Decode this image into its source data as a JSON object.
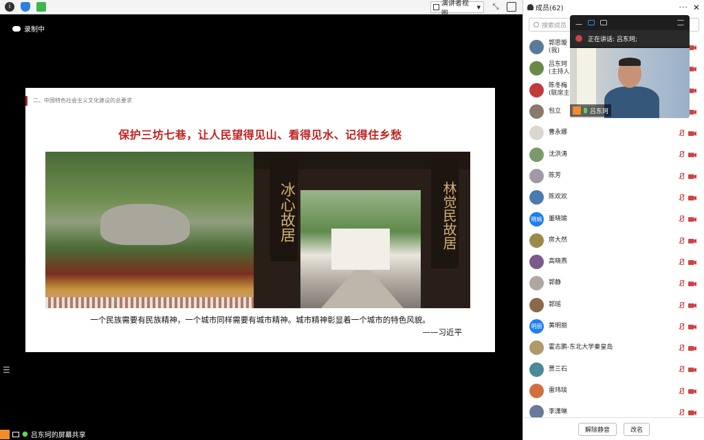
{
  "toolbar": {
    "view_label": "演讲者视图"
  },
  "recording": {
    "label": "录制中"
  },
  "slide": {
    "section": "二、中国特色社会主义文化建设的总要求",
    "title": "保护三坊七巷，让人民望得见山、看得见水、记得住乡愁",
    "quote": "一个民族需要有民族精神，一个城市同样需要有城市精神。城市精神彰显着一个城市的特色风貌。",
    "author": "——习近平",
    "plaque_left": "冰心故居",
    "plaque_right": "林觉民故居"
  },
  "share_bar": {
    "label": "吕东珂的屏幕共享"
  },
  "panel": {
    "title": "成员(62)",
    "search_placeholder": "搜索成员",
    "members": [
      {
        "name": "郭思璇",
        "sub": "(我)",
        "color": "#5a7a99"
      },
      {
        "name": "吕东珂",
        "sub": "(主持人)",
        "color": "#6a8a4a"
      },
      {
        "name": "陈冬梅",
        "sub": "(联席主持)",
        "color": "#c23b3b"
      },
      {
        "name": "包立",
        "sub": "",
        "color": "#8a7a6a"
      },
      {
        "name": "曹永娜",
        "sub": "",
        "color": "#dcd6d0"
      },
      {
        "name": "沈洪涛",
        "sub": "",
        "color": "#7a9a6a"
      },
      {
        "name": "陈芳",
        "sub": "",
        "color": "#a09aa8"
      },
      {
        "name": "陈欢欢",
        "sub": "",
        "color": "#4a7ab0"
      },
      {
        "name": "董晓瑜",
        "sub": "",
        "color": "#1f7ef2",
        "initials": "晓瑜"
      },
      {
        "name": "房大然",
        "sub": "",
        "color": "#9a8a4a"
      },
      {
        "name": "高晓燕",
        "sub": "",
        "color": "#7a5a8a"
      },
      {
        "name": "郭静",
        "sub": "",
        "color": "#b0a8a0"
      },
      {
        "name": "郭瑶",
        "sub": "",
        "color": "#8a6a4a"
      },
      {
        "name": "黄明丽",
        "sub": "",
        "color": "#1f7ef2",
        "initials": "明丽"
      },
      {
        "name": "霍志鹏-东北大学秦皇岛",
        "sub": "",
        "color": "#b09a6a"
      },
      {
        "name": "贾三石",
        "sub": "",
        "color": "#4a8a9a"
      },
      {
        "name": "雷玮琰",
        "sub": "",
        "color": "#d07040"
      },
      {
        "name": "李潇琳",
        "sub": "",
        "color": "#6a7a9a"
      }
    ],
    "unmute_button": "解除静音",
    "rename_button": "改名"
  },
  "speaker": {
    "talking_label": "正在讲话: 吕东珂;",
    "name": "吕东珂"
  }
}
